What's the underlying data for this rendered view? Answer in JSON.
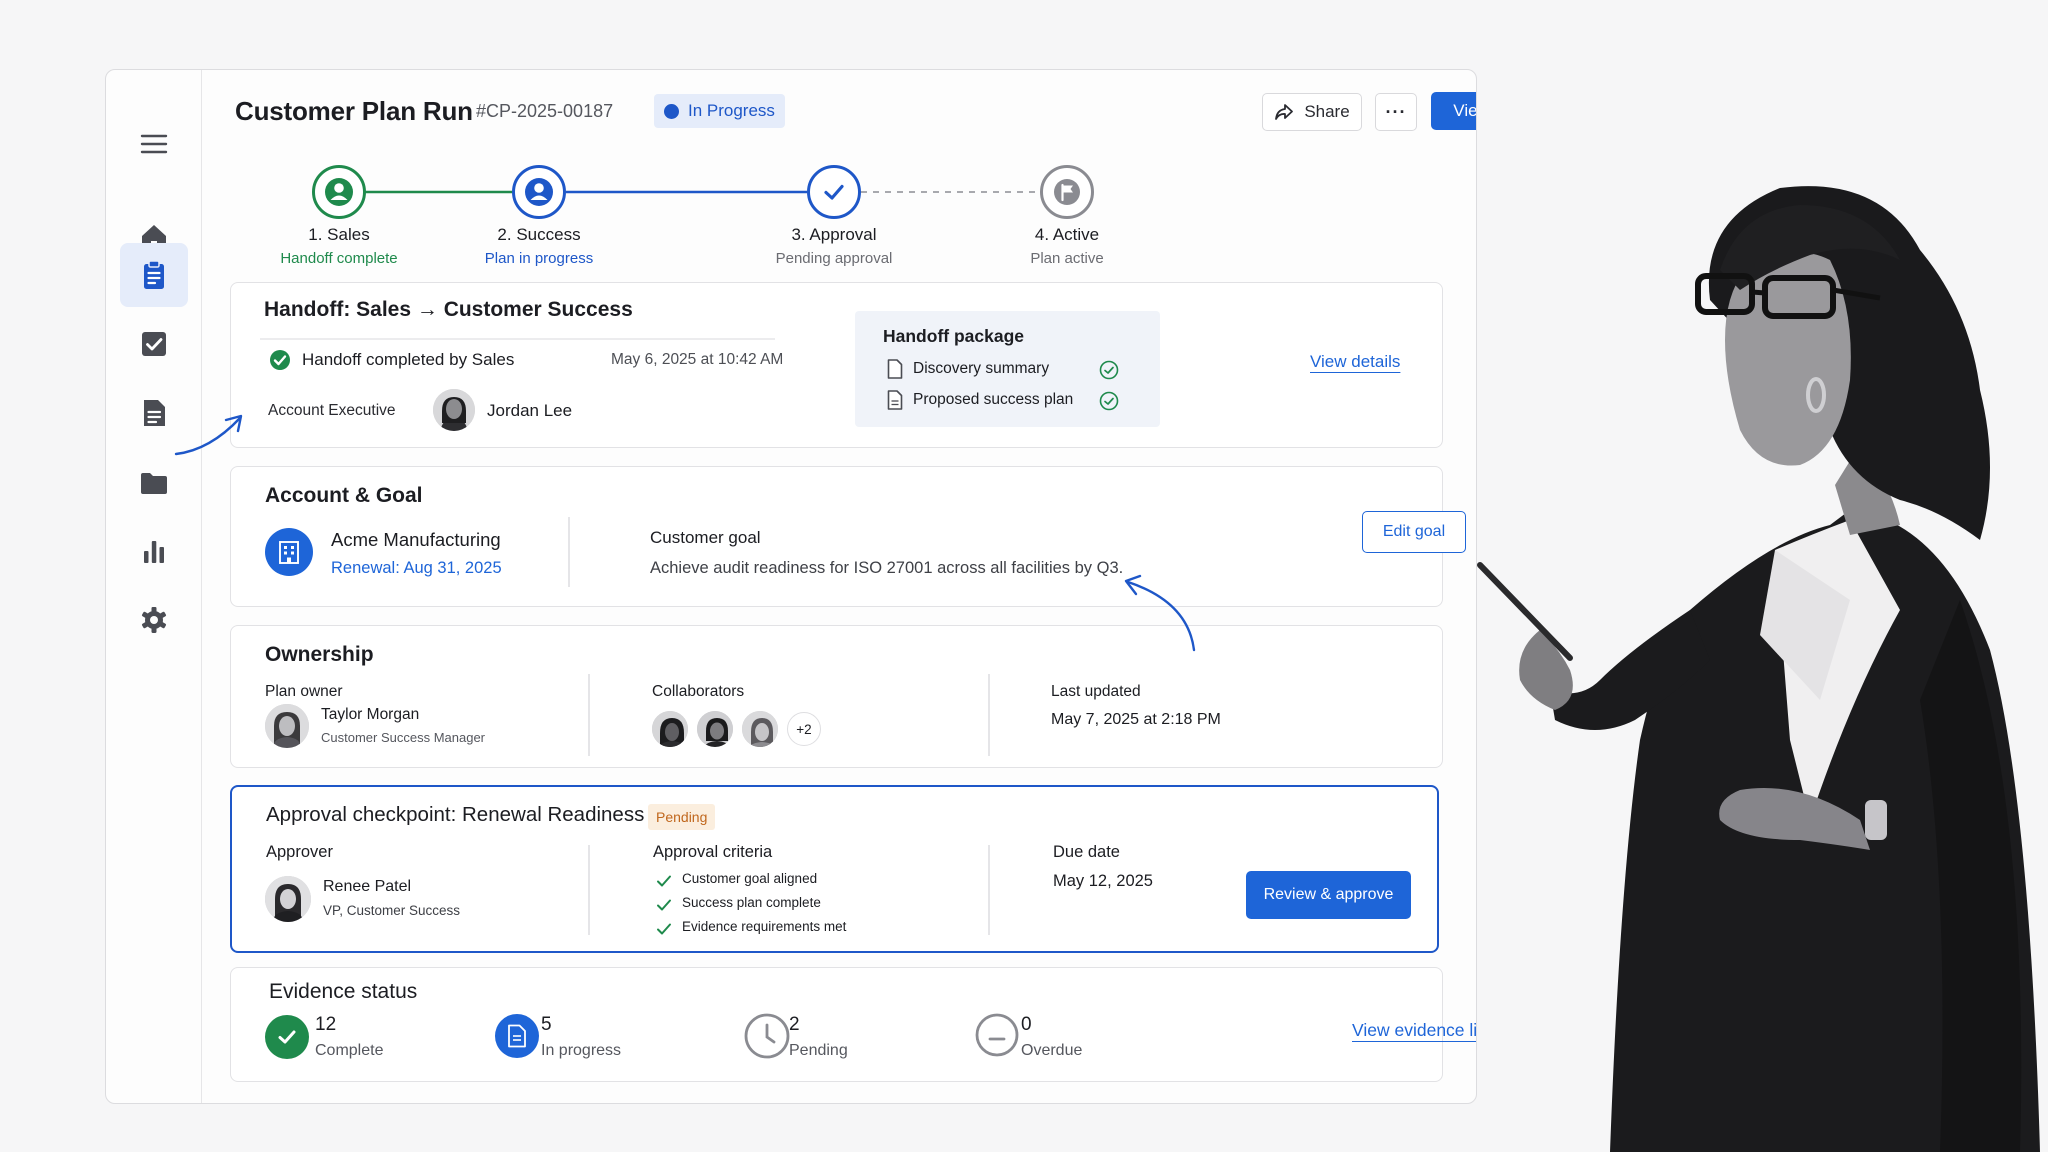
{
  "header": {
    "title": "Customer Plan Run",
    "id": "#CP-2025-00187",
    "status": "In Progress",
    "share_label": "Share",
    "more_label": "···",
    "view_plan_label": "View plan"
  },
  "steps": [
    {
      "label": "1. Sales",
      "sub": "Handoff complete",
      "state": "complete",
      "color": "#1f8a4c"
    },
    {
      "label": "2. Success",
      "sub": "Plan in progress",
      "state": "in-progress",
      "color": "#1e57c8"
    },
    {
      "label": "3. Approval",
      "sub": "Pending approval",
      "state": "pending",
      "color": "#1e57c8"
    },
    {
      "label": "4. Active",
      "sub": "Plan active",
      "state": "upcoming",
      "color": "#8a8b91"
    }
  ],
  "handoff": {
    "title": "Handoff: Sales → Customer Success",
    "completed_text": "Handoff completed by Sales",
    "completed_date": "May 6, 2025 at 10:42 AM",
    "role_label": "Account Executive",
    "person": "Jordan Lee",
    "package_title": "Handoff package",
    "package_items": [
      "Discovery summary",
      "Proposed success plan"
    ],
    "view_details": "View details"
  },
  "account": {
    "title": "Account & Goal",
    "company": "Acme Manufacturing",
    "renewal": "Renewal: Aug 31, 2025",
    "goal_label": "Customer goal",
    "goal_text": "Achieve audit readiness for ISO 27001 across all facilities by Q3.",
    "edit_goal": "Edit goal"
  },
  "ownership": {
    "title": "Ownership",
    "owner_label": "Plan owner",
    "owner_name": "Taylor Morgan",
    "owner_role": "Customer Success Manager",
    "collab_label": "Collaborators",
    "collab_more": "+2",
    "updated_label": "Last updated",
    "updated_value": "May 7, 2025 at 2:18 PM"
  },
  "approval": {
    "title": "Approval checkpoint: Renewal Readiness",
    "badge": "Pending",
    "approver_label": "Approver",
    "approver_name": "Renee Patel",
    "approver_role": "VP, Customer Success",
    "criteria_label": "Approval criteria",
    "criteria": [
      "Customer goal aligned",
      "Success plan complete",
      "Evidence requirements met"
    ],
    "due_label": "Due date",
    "due_value": "May 12, 2025",
    "review_button": "Review & approve"
  },
  "evidence": {
    "title": "Evidence status",
    "stats": [
      {
        "count": "12",
        "label": "Complete"
      },
      {
        "count": "5",
        "label": "In progress"
      },
      {
        "count": "2",
        "label": "Pending"
      },
      {
        "count": "0",
        "label": "Overdue"
      }
    ],
    "library_link": "View evidence library"
  },
  "sidebar": {
    "icons": [
      "menu-icon",
      "home-icon",
      "clipboard-icon",
      "checkbox-icon",
      "document-icon",
      "folder-icon",
      "bar-chart-icon",
      "gear-icon"
    ],
    "active": "clipboard-icon"
  },
  "colors": {
    "accent": "#1e65d8",
    "success": "#1f8a4c",
    "pending_badge_bg": "#fbeede",
    "pending_badge_text": "#c0671d"
  }
}
